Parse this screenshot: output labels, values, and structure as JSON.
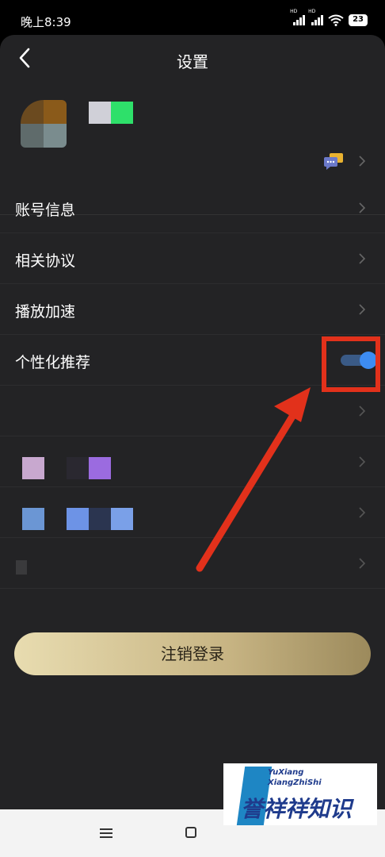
{
  "status_bar": {
    "time": "晚上8:39",
    "signal_label_1": "HD",
    "signal_label_2": "HD",
    "battery": "23"
  },
  "header": {
    "title": "设置",
    "back_icon": "chevron-left-icon"
  },
  "profile": {
    "message_icon": "chat-bubble-icon"
  },
  "menu": {
    "items": [
      {
        "label": "账号信息"
      },
      {
        "label": "相关协议"
      },
      {
        "label": "播放加速"
      },
      {
        "label": "个性化推荐",
        "toggle_on": true
      }
    ]
  },
  "logout_button": {
    "label": "注销登录"
  },
  "watermark": {
    "line1": "YuXiang",
    "line2": "XiangZhiShi",
    "chinese": "誉祥祥知识"
  },
  "colors": {
    "panel_bg": "#232325",
    "toggle_on": "#3d8cf2",
    "highlight": "#e2311b",
    "logout_gold": "#d6c79a"
  }
}
